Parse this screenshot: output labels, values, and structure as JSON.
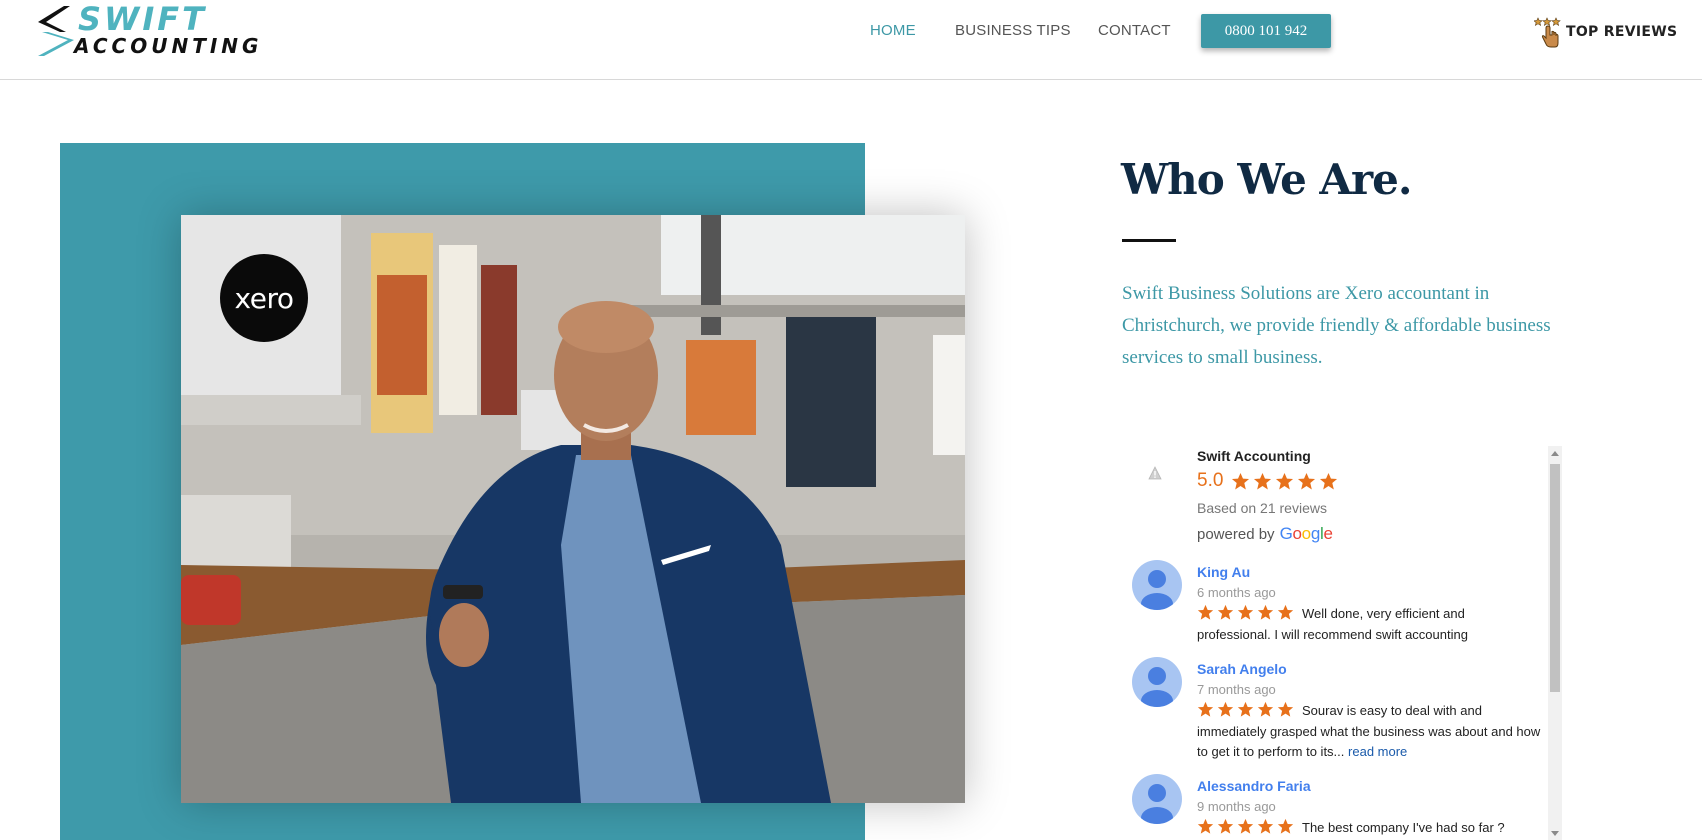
{
  "brand": {
    "name_top": "SWIFT",
    "name_bottom": "ACCOUNTING",
    "accent": "#3e9aaa",
    "logo_cyan": "#4fb3bf"
  },
  "nav": {
    "items": [
      {
        "label": "HOME",
        "active": true
      },
      {
        "label": "BUSINESS TIPS",
        "active": false
      },
      {
        "label": "CONTACT",
        "active": false
      }
    ],
    "phone": "0800 101 942",
    "top_reviews_label": "TOP REVIEWS",
    "top_reviews_icon": "three-stars-pointing-hand-icon"
  },
  "hero": {
    "photo_badge": "xero",
    "title": "Who We Are.",
    "intro": "Swift Business Solutions are Xero accountant in Christchurch, we provide friendly & affordable business services to small business."
  },
  "reviews_widget": {
    "business_name": "Swift Accounting",
    "rating": "5.0",
    "star_count": 5,
    "star_color": "#e7711b",
    "based_on": "Based on 21 reviews",
    "powered_by": "powered by",
    "google_word": "Google",
    "reviews": [
      {
        "author": "King Au",
        "time": "6 months ago",
        "text": "Well done, very efficient and professional. I will recommend swift accounting",
        "read_more": ""
      },
      {
        "author": "Sarah Angelo",
        "time": "7 months ago",
        "text": "Sourav is easy to deal with and immediately grasped what the business was about and how to get it to perform to its...",
        "read_more": "read more"
      },
      {
        "author": "Alessandro Faria",
        "time": "9 months ago",
        "text": "The best company I've had so far ?",
        "read_more": ""
      }
    ]
  }
}
